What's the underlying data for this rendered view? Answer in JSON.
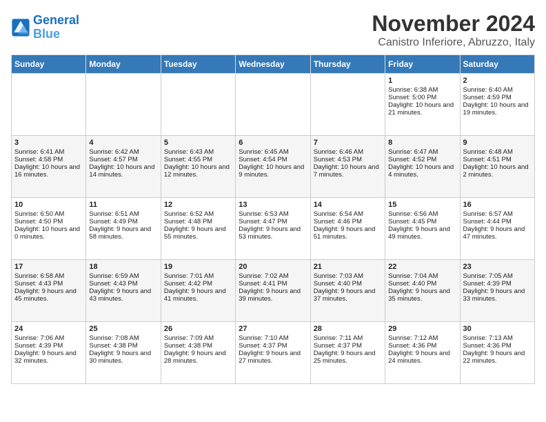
{
  "header": {
    "logo": "GeneralBlue",
    "month": "November 2024",
    "location": "Canistro Inferiore, Abruzzo, Italy"
  },
  "days_of_week": [
    "Sunday",
    "Monday",
    "Tuesday",
    "Wednesday",
    "Thursday",
    "Friday",
    "Saturday"
  ],
  "weeks": [
    [
      {
        "day": "",
        "sunrise": "",
        "sunset": "",
        "daylight": ""
      },
      {
        "day": "",
        "sunrise": "",
        "sunset": "",
        "daylight": ""
      },
      {
        "day": "",
        "sunrise": "",
        "sunset": "",
        "daylight": ""
      },
      {
        "day": "",
        "sunrise": "",
        "sunset": "",
        "daylight": ""
      },
      {
        "day": "",
        "sunrise": "",
        "sunset": "",
        "daylight": ""
      },
      {
        "day": "1",
        "sunrise": "Sunrise: 6:38 AM",
        "sunset": "Sunset: 5:00 PM",
        "daylight": "Daylight: 10 hours and 21 minutes."
      },
      {
        "day": "2",
        "sunrise": "Sunrise: 6:40 AM",
        "sunset": "Sunset: 4:59 PM",
        "daylight": "Daylight: 10 hours and 19 minutes."
      }
    ],
    [
      {
        "day": "3",
        "sunrise": "Sunrise: 6:41 AM",
        "sunset": "Sunset: 4:58 PM",
        "daylight": "Daylight: 10 hours and 16 minutes."
      },
      {
        "day": "4",
        "sunrise": "Sunrise: 6:42 AM",
        "sunset": "Sunset: 4:57 PM",
        "daylight": "Daylight: 10 hours and 14 minutes."
      },
      {
        "day": "5",
        "sunrise": "Sunrise: 6:43 AM",
        "sunset": "Sunset: 4:55 PM",
        "daylight": "Daylight: 10 hours and 12 minutes."
      },
      {
        "day": "6",
        "sunrise": "Sunrise: 6:45 AM",
        "sunset": "Sunset: 4:54 PM",
        "daylight": "Daylight: 10 hours and 9 minutes."
      },
      {
        "day": "7",
        "sunrise": "Sunrise: 6:46 AM",
        "sunset": "Sunset: 4:53 PM",
        "daylight": "Daylight: 10 hours and 7 minutes."
      },
      {
        "day": "8",
        "sunrise": "Sunrise: 6:47 AM",
        "sunset": "Sunset: 4:52 PM",
        "daylight": "Daylight: 10 hours and 4 minutes."
      },
      {
        "day": "9",
        "sunrise": "Sunrise: 6:48 AM",
        "sunset": "Sunset: 4:51 PM",
        "daylight": "Daylight: 10 hours and 2 minutes."
      }
    ],
    [
      {
        "day": "10",
        "sunrise": "Sunrise: 6:50 AM",
        "sunset": "Sunset: 4:50 PM",
        "daylight": "Daylight: 10 hours and 0 minutes."
      },
      {
        "day": "11",
        "sunrise": "Sunrise: 6:51 AM",
        "sunset": "Sunset: 4:49 PM",
        "daylight": "Daylight: 9 hours and 58 minutes."
      },
      {
        "day": "12",
        "sunrise": "Sunrise: 6:52 AM",
        "sunset": "Sunset: 4:48 PM",
        "daylight": "Daylight: 9 hours and 55 minutes."
      },
      {
        "day": "13",
        "sunrise": "Sunrise: 6:53 AM",
        "sunset": "Sunset: 4:47 PM",
        "daylight": "Daylight: 9 hours and 53 minutes."
      },
      {
        "day": "14",
        "sunrise": "Sunrise: 6:54 AM",
        "sunset": "Sunset: 4:46 PM",
        "daylight": "Daylight: 9 hours and 51 minutes."
      },
      {
        "day": "15",
        "sunrise": "Sunrise: 6:56 AM",
        "sunset": "Sunset: 4:45 PM",
        "daylight": "Daylight: 9 hours and 49 minutes."
      },
      {
        "day": "16",
        "sunrise": "Sunrise: 6:57 AM",
        "sunset": "Sunset: 4:44 PM",
        "daylight": "Daylight: 9 hours and 47 minutes."
      }
    ],
    [
      {
        "day": "17",
        "sunrise": "Sunrise: 6:58 AM",
        "sunset": "Sunset: 4:43 PM",
        "daylight": "Daylight: 9 hours and 45 minutes."
      },
      {
        "day": "18",
        "sunrise": "Sunrise: 6:59 AM",
        "sunset": "Sunset: 4:43 PM",
        "daylight": "Daylight: 9 hours and 43 minutes."
      },
      {
        "day": "19",
        "sunrise": "Sunrise: 7:01 AM",
        "sunset": "Sunset: 4:42 PM",
        "daylight": "Daylight: 9 hours and 41 minutes."
      },
      {
        "day": "20",
        "sunrise": "Sunrise: 7:02 AM",
        "sunset": "Sunset: 4:41 PM",
        "daylight": "Daylight: 9 hours and 39 minutes."
      },
      {
        "day": "21",
        "sunrise": "Sunrise: 7:03 AM",
        "sunset": "Sunset: 4:40 PM",
        "daylight": "Daylight: 9 hours and 37 minutes."
      },
      {
        "day": "22",
        "sunrise": "Sunrise: 7:04 AM",
        "sunset": "Sunset: 4:40 PM",
        "daylight": "Daylight: 9 hours and 35 minutes."
      },
      {
        "day": "23",
        "sunrise": "Sunrise: 7:05 AM",
        "sunset": "Sunset: 4:39 PM",
        "daylight": "Daylight: 9 hours and 33 minutes."
      }
    ],
    [
      {
        "day": "24",
        "sunrise": "Sunrise: 7:06 AM",
        "sunset": "Sunset: 4:39 PM",
        "daylight": "Daylight: 9 hours and 32 minutes."
      },
      {
        "day": "25",
        "sunrise": "Sunrise: 7:08 AM",
        "sunset": "Sunset: 4:38 PM",
        "daylight": "Daylight: 9 hours and 30 minutes."
      },
      {
        "day": "26",
        "sunrise": "Sunrise: 7:09 AM",
        "sunset": "Sunset: 4:38 PM",
        "daylight": "Daylight: 9 hours and 28 minutes."
      },
      {
        "day": "27",
        "sunrise": "Sunrise: 7:10 AM",
        "sunset": "Sunset: 4:37 PM",
        "daylight": "Daylight: 9 hours and 27 minutes."
      },
      {
        "day": "28",
        "sunrise": "Sunrise: 7:11 AM",
        "sunset": "Sunset: 4:37 PM",
        "daylight": "Daylight: 9 hours and 25 minutes."
      },
      {
        "day": "29",
        "sunrise": "Sunrise: 7:12 AM",
        "sunset": "Sunset: 4:36 PM",
        "daylight": "Daylight: 9 hours and 24 minutes."
      },
      {
        "day": "30",
        "sunrise": "Sunrise: 7:13 AM",
        "sunset": "Sunset: 4:36 PM",
        "daylight": "Daylight: 9 hours and 22 minutes."
      }
    ]
  ]
}
